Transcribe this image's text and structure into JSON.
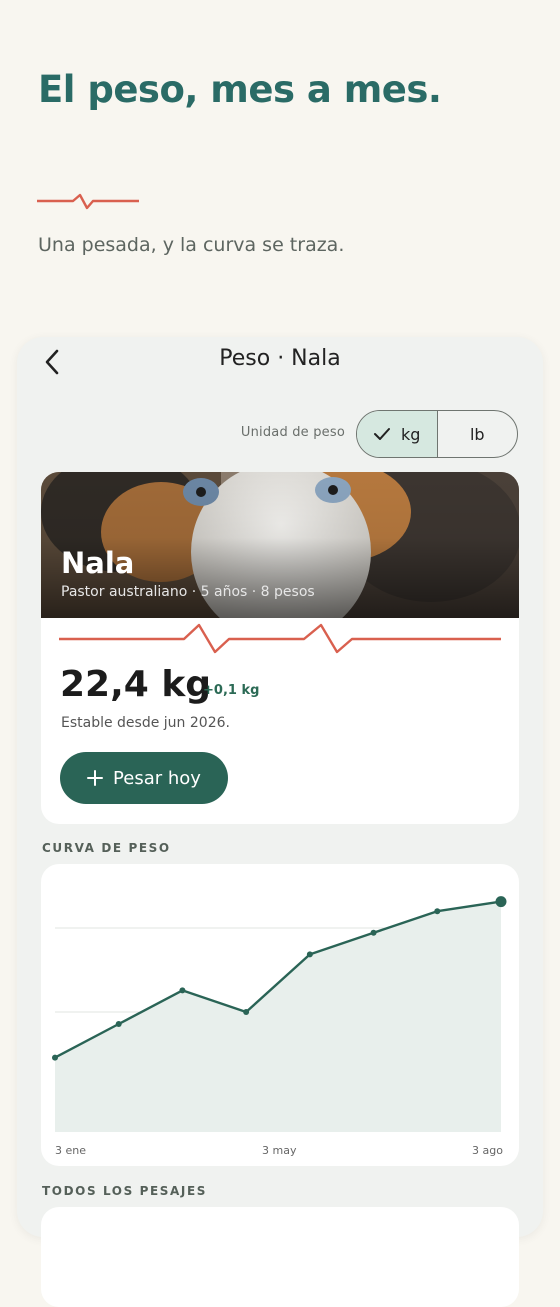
{
  "hero": {
    "title": "El peso, mes a mes.",
    "subtitle": "Una pesada, y la curva se traza.",
    "accent_color": "#d9604f"
  },
  "app": {
    "title": "Peso · Nala",
    "back_icon": "chevron-left-icon"
  },
  "unit": {
    "label": "Unidad de peso",
    "options": [
      "kg",
      "lb"
    ],
    "selected": "kg"
  },
  "pet": {
    "name": "Nala",
    "meta": "Pastor australiano · 5 años · 8 pesos",
    "weight": "22,4 kg",
    "delta": "+0,1 kg",
    "status": "Estable desde jun 2026.",
    "weigh_button": "Pesar hoy"
  },
  "sections": {
    "curve": "CURVA DE PESO",
    "all": "TODOS LOS PESAJES"
  },
  "chart_data": {
    "type": "area",
    "x_ticks": [
      "3 ene",
      "3 may",
      "3 ago"
    ],
    "values": [
      0.31,
      0.45,
      0.59,
      0.5,
      0.74,
      0.83,
      0.92,
      0.96
    ],
    "series_color": "#2a6456"
  }
}
